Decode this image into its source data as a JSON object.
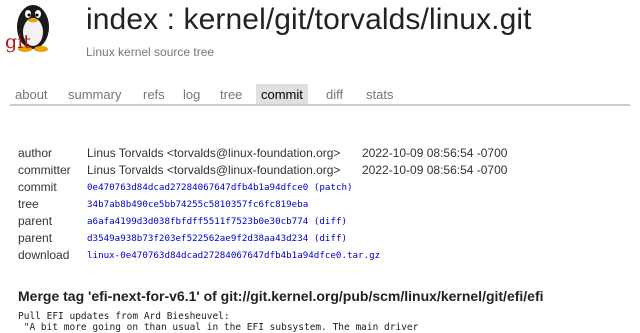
{
  "header": {
    "logo_text": "git",
    "title": "index : kernel/git/torvalds/linux.git",
    "subtitle": "Linux kernel source tree"
  },
  "tabs": [
    {
      "label": "about"
    },
    {
      "label": "summary"
    },
    {
      "label": "refs"
    },
    {
      "label": "log"
    },
    {
      "label": "tree"
    },
    {
      "label": "commit"
    },
    {
      "label": "diff"
    },
    {
      "label": "stats"
    }
  ],
  "active_tab": "commit",
  "commit_info": {
    "author_label": "author",
    "author": "Linus Torvalds <torvalds@linux-foundation.org>",
    "author_date": "2022-10-09 08:56:54 -0700",
    "committer_label": "committer",
    "committer": "Linus Torvalds <torvalds@linux-foundation.org>",
    "committer_date": "2022-10-09 08:56:54 -0700",
    "commit_label": "commit",
    "commit_hash": "0e470763d84dcad27284067647dfb4b1a94dfce0",
    "commit_patch": "(patch)",
    "tree_label": "tree",
    "tree_hash": "34b7ab8b490ce5bb74255c5810357fc6fc819eba",
    "parent_label": "parent",
    "parent1_hash": "a6afa4199d3d038fbfdff5511f7523b0e30cb774",
    "parent1_diff": "(diff)",
    "parent2_hash": "d3549a938b73f203ef522562ae9f2d38aa43d234",
    "parent2_diff": "(diff)",
    "download_label": "download",
    "download_file": "linux-0e470763d84dcad27284067647dfb4b1a94dfce0.tar.gz"
  },
  "commit_subject": "Merge tag 'efi-next-for-v6.1' of git://git.kernel.org/pub/scm/linux/kernel/git/efi/efi",
  "commit_body": "Pull EFI updates from Ard Biesheuvel:\n \"A bit more going on than usual in the EFI subsystem. The main driver"
}
